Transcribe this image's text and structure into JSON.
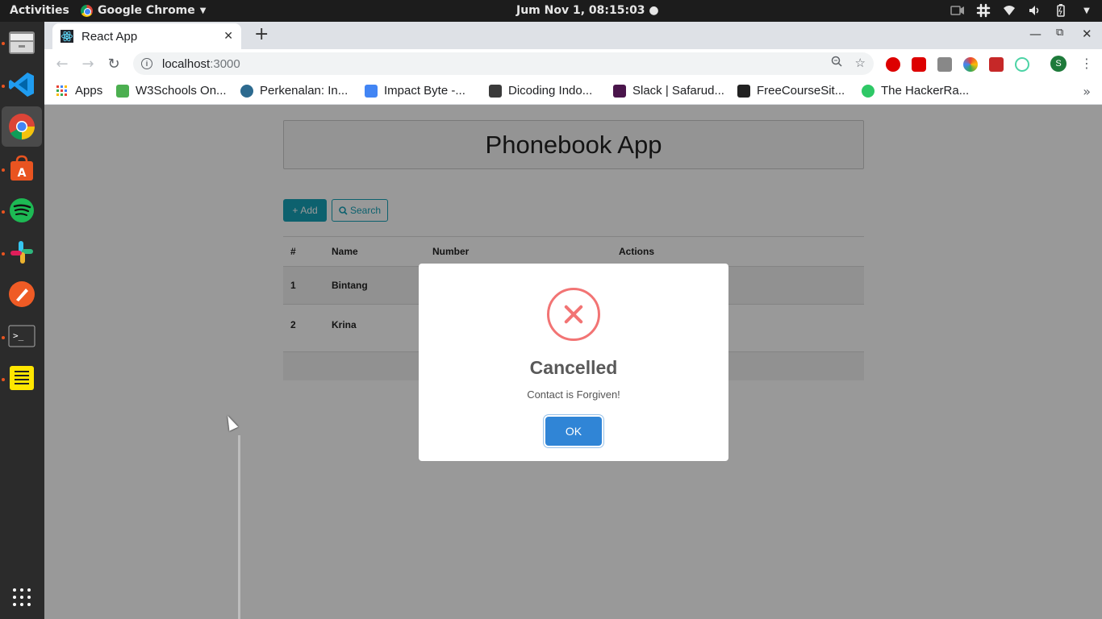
{
  "topbar": {
    "activities": "Activities",
    "app_name": "Google Chrome",
    "clock": "Jum Nov  1, 08:15:03 ●"
  },
  "dock": {
    "items": [
      "files",
      "vscode",
      "chrome",
      "software-center",
      "spotify",
      "slack",
      "postman",
      "terminal",
      "notes",
      "show-apps"
    ]
  },
  "browser": {
    "tab_title": "React App",
    "url_host": "localhost",
    "url_port": ":3000",
    "bookmarks": [
      {
        "label": "Apps",
        "color": "#4285f4"
      },
      {
        "label": "W3Schools On...",
        "color": "#4caf50"
      },
      {
        "label": "Perkenalan: In...",
        "color": "#2d6a8f"
      },
      {
        "label": "Impact Byte -...",
        "color": "#4285f4"
      },
      {
        "label": "Dicoding Indo...",
        "color": "#3a3a3a"
      },
      {
        "label": "Slack | Safarud...",
        "color": "#4a154b"
      },
      {
        "label": "FreeCourseSit...",
        "color": "#222222"
      },
      {
        "label": "The HackerRa...",
        "color": "#2ec866"
      }
    ]
  },
  "app": {
    "title": "Phonebook App",
    "add_label": "Add",
    "search_label": "Search",
    "table": {
      "headers": [
        "#",
        "Name",
        "Number",
        "Actions"
      ],
      "rows": [
        {
          "no": "1",
          "name": "Bintang"
        },
        {
          "no": "2",
          "name": "Krina"
        }
      ]
    }
  },
  "modal": {
    "title": "Cancelled",
    "text": "Contact is Forgiven!",
    "ok_label": "OK",
    "icon": "error-x-icon",
    "color": "#f27474",
    "button_color": "#3085d6"
  }
}
